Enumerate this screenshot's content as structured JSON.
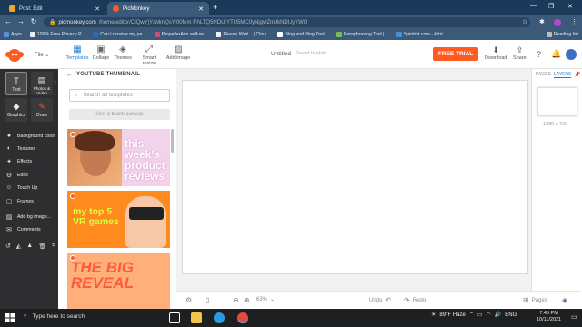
{
  "browser": {
    "tabs": [
      {
        "title": "Post: Edit",
        "active": false
      },
      {
        "title": "PicMonkey",
        "active": true
      }
    ],
    "url_main": "picmonkey.com",
    "url_rest": "/home/editor/CIQwYjYsMmQsYi00Mm RhLTQ5NDUtYTU5MC0yNjgwZmJkNDUyYWQ",
    "bookmarks": [
      {
        "label": "Apps",
        "color": "#5b8fd6"
      },
      {
        "label": "100% Free Privacy P...",
        "color": "#e8eef5"
      },
      {
        "label": "Can I receive my pa...",
        "color": "#2b6cb0"
      },
      {
        "label": "PropellerAds self-se...",
        "color": "#d04a7a"
      },
      {
        "label": "Please Wait... | Clou...",
        "color": "#f0f0f0"
      },
      {
        "label": "Blog and Ping Tool...",
        "color": "#ffffff"
      },
      {
        "label": "Paraphrasing Tool |...",
        "color": "#7dbb5a"
      },
      {
        "label": "Spinbot.com - Artic...",
        "color": "#4a8fd0"
      },
      {
        "label": "Reading list",
        "color": "#bbbbbb"
      }
    ]
  },
  "header": {
    "file_menu": "File",
    "nav": [
      {
        "label": "Templates",
        "icon": "templates-icon",
        "glyph": "▦",
        "active": true
      },
      {
        "label": "Collage",
        "icon": "collage-icon",
        "glyph": "▣",
        "active": false
      },
      {
        "label": "Themes",
        "icon": "themes-icon",
        "glyph": "◈",
        "active": false
      },
      {
        "label": "Smart resize",
        "icon": "smart-resize-icon",
        "glyph": "⤢",
        "active": false
      },
      {
        "label": "Add image",
        "icon": "add-image-icon",
        "glyph": "🖼",
        "active": false
      }
    ],
    "doc_title": "Untitled",
    "doc_status": "Saved to Hub",
    "trial_button": "FREE TRIAL",
    "download": "Download",
    "share": "Share"
  },
  "left_tools": {
    "buttons": [
      {
        "label": "Text",
        "glyph": "T",
        "icon": "text-icon",
        "active": true
      },
      {
        "label": "Photos & Video",
        "glyph": "▤",
        "icon": "photos-video-icon",
        "active": false
      },
      {
        "label": "Graphics",
        "glyph": "◆",
        "icon": "graphics-icon",
        "active": false
      },
      {
        "label": "Draw",
        "glyph": "✎",
        "icon": "draw-icon",
        "active": false
      }
    ],
    "items": [
      {
        "label": "Background color",
        "glyph": "●",
        "icon": "background-color-icon"
      },
      {
        "label": "Textures",
        "glyph": "◐",
        "icon": "textures-icon"
      },
      {
        "label": "Effects",
        "glyph": "✦",
        "icon": "effects-icon"
      },
      {
        "label": "Edits",
        "glyph": "⚙",
        "icon": "edits-icon"
      },
      {
        "label": "Touch Up",
        "glyph": "☺",
        "icon": "touch-up-icon"
      },
      {
        "label": "Frames",
        "glyph": "▢",
        "icon": "frames-icon"
      },
      {
        "label": "Add bg image...",
        "glyph": "▨",
        "icon": "add-bg-image-icon"
      },
      {
        "label": "Comments",
        "glyph": "💬",
        "icon": "comments-icon"
      }
    ]
  },
  "panel": {
    "title": "YOUTUBE THUMBNAIL",
    "search_placeholder": "Search all templates",
    "blank_button": "Use a blank canvas",
    "thumbnails": [
      {
        "text": "this week's product reviews",
        "bg": "#f3d3ea",
        "fg": "#ffffff"
      },
      {
        "text": "my top 5 VR games",
        "bg": "#ff8a1e",
        "fg": "#d9ff3a"
      },
      {
        "text": "THE BIG REVEAL",
        "bg": "#ffb07a",
        "fg": "#ff5a3a"
      }
    ]
  },
  "bottom_bar": {
    "zoom": "63%",
    "undo": "Undo",
    "redo": "Redo",
    "pages": "Pages"
  },
  "right_panel": {
    "tabs": [
      {
        "label": "PAGES",
        "active": false
      },
      {
        "label": "LAYERS",
        "active": true
      }
    ],
    "page_size": "1280 x 720"
  },
  "taskbar": {
    "search_placeholder": "Type here to search",
    "weather": "89°F  Haze",
    "language": "ENG",
    "time": "7:45 PM",
    "date": "10/11/2021"
  }
}
